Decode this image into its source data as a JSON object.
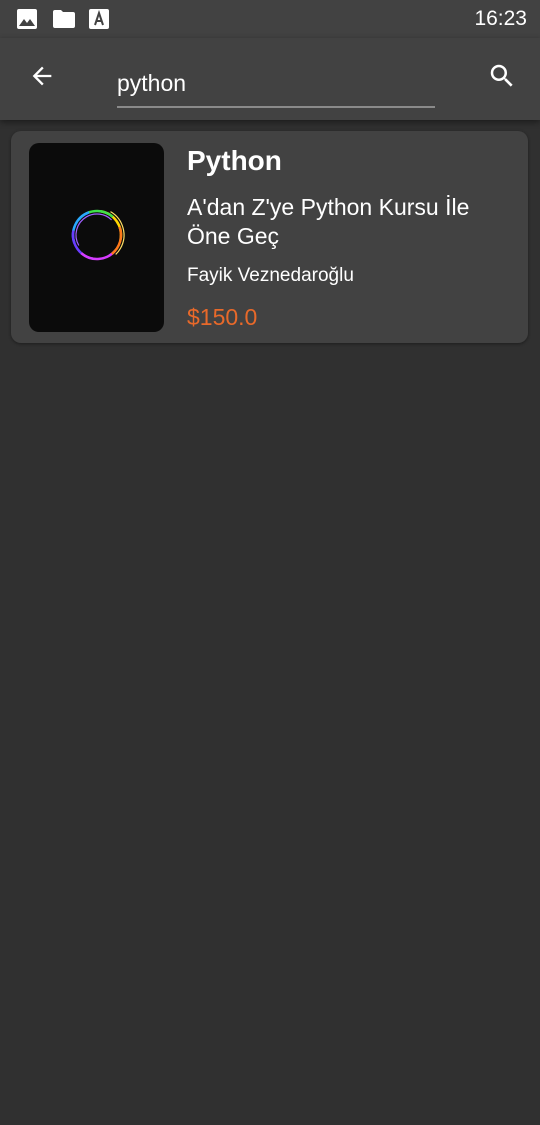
{
  "status_bar": {
    "time": "16:23",
    "icons": [
      "image-icon",
      "folder-icon",
      "font-a-icon"
    ]
  },
  "app_bar": {
    "back_icon": "arrow-back-icon",
    "search_value": "python",
    "search_icon": "search-icon"
  },
  "results": [
    {
      "category": "Python",
      "title": "A'dan Z'ye Python Kursu İle Öne Geç",
      "author": "Fayik Veznedaroğlu",
      "price": "$150.0",
      "thumbnail_icon": "rainbow-ring-logo"
    }
  ],
  "colors": {
    "background": "#303030",
    "surface": "#424242",
    "price": "#e8692a"
  }
}
